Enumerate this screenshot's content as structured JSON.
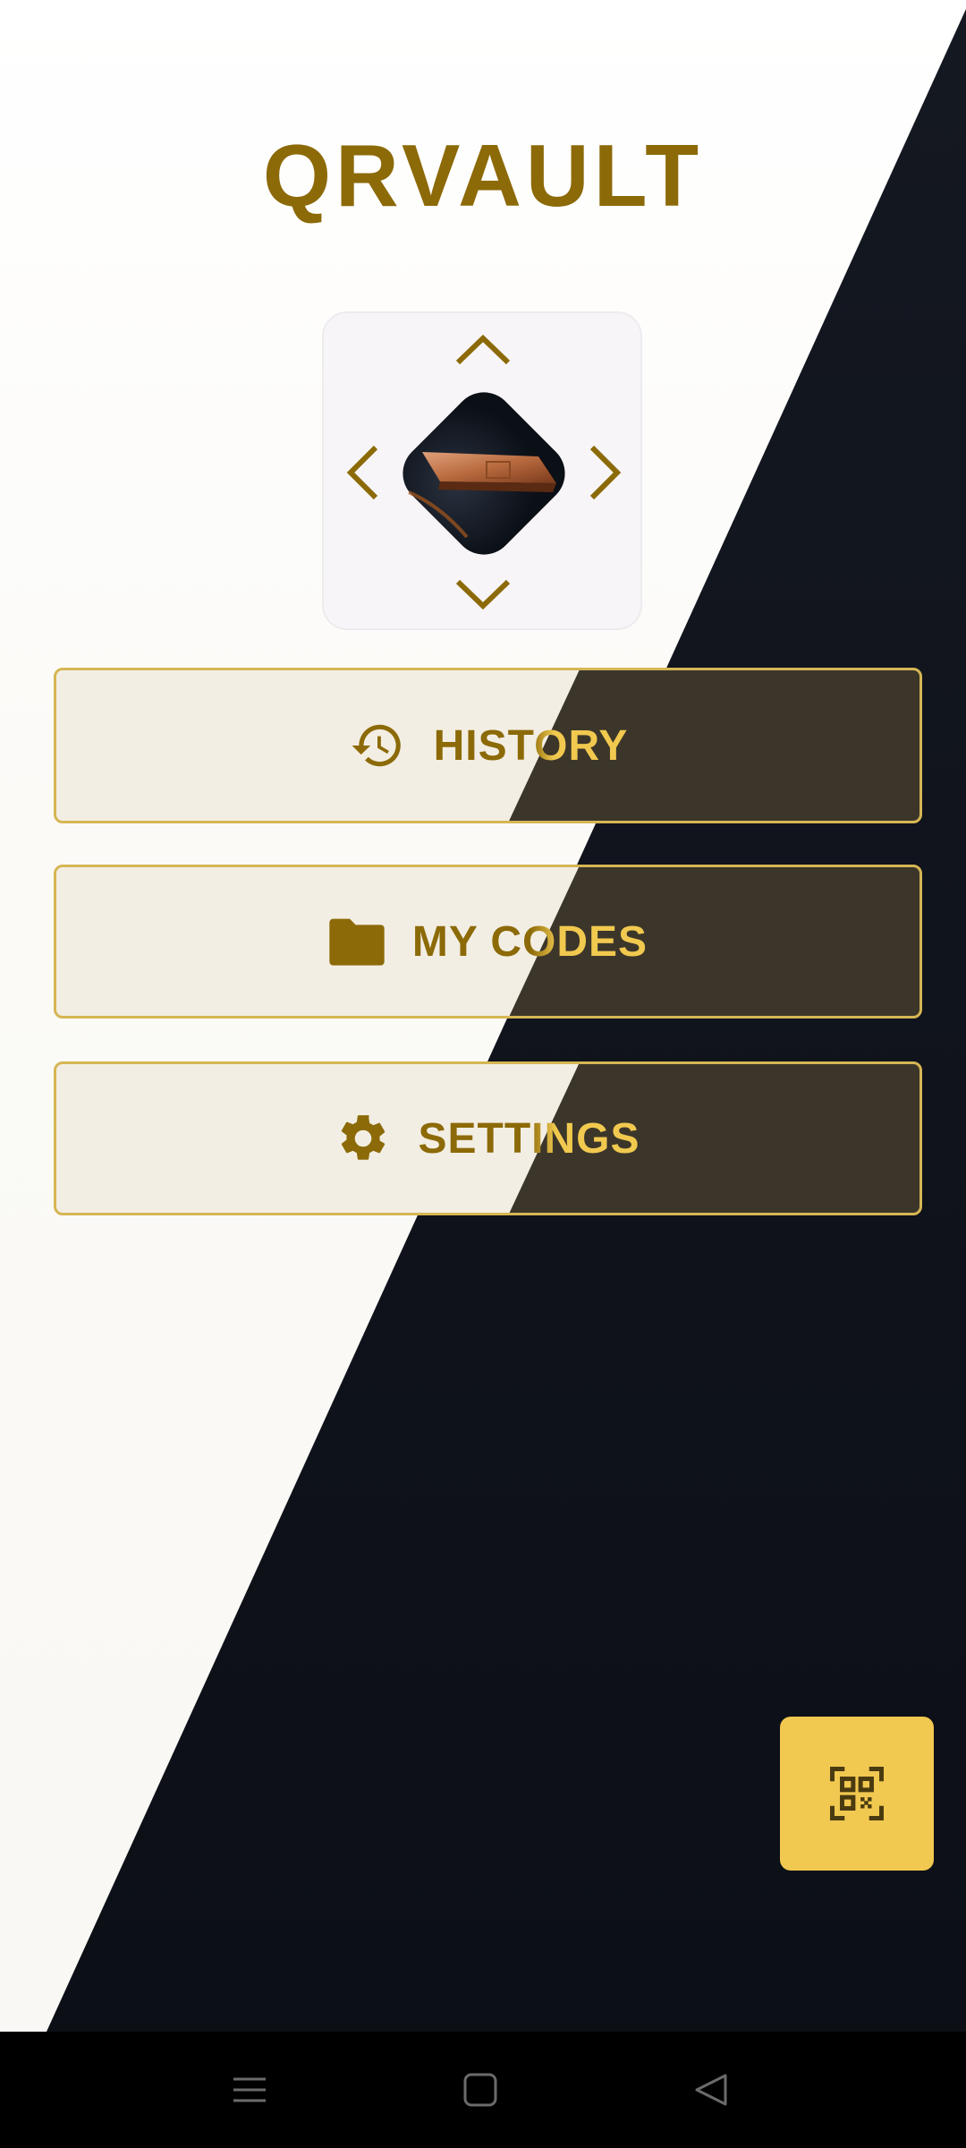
{
  "app": {
    "title": "QRVAULT"
  },
  "menu": {
    "history_label": "HISTORY",
    "codes_label": "MY CODES",
    "settings_label": "SETTINGS"
  },
  "icons": {
    "history": "history-icon",
    "folder": "folder-icon",
    "settings": "gear-icon",
    "scan": "qr-scan-icon",
    "arrows": [
      "chevron-up-icon",
      "chevron-down-icon",
      "chevron-left-icon",
      "chevron-right-icon"
    ],
    "nav": [
      "menu-icon",
      "home-square-icon",
      "back-triangle-icon"
    ]
  },
  "colors": {
    "gold": "#8c6a08",
    "accent_gold": "#f1c850",
    "dark": "#0e1219",
    "light": "#fbfaf7"
  }
}
